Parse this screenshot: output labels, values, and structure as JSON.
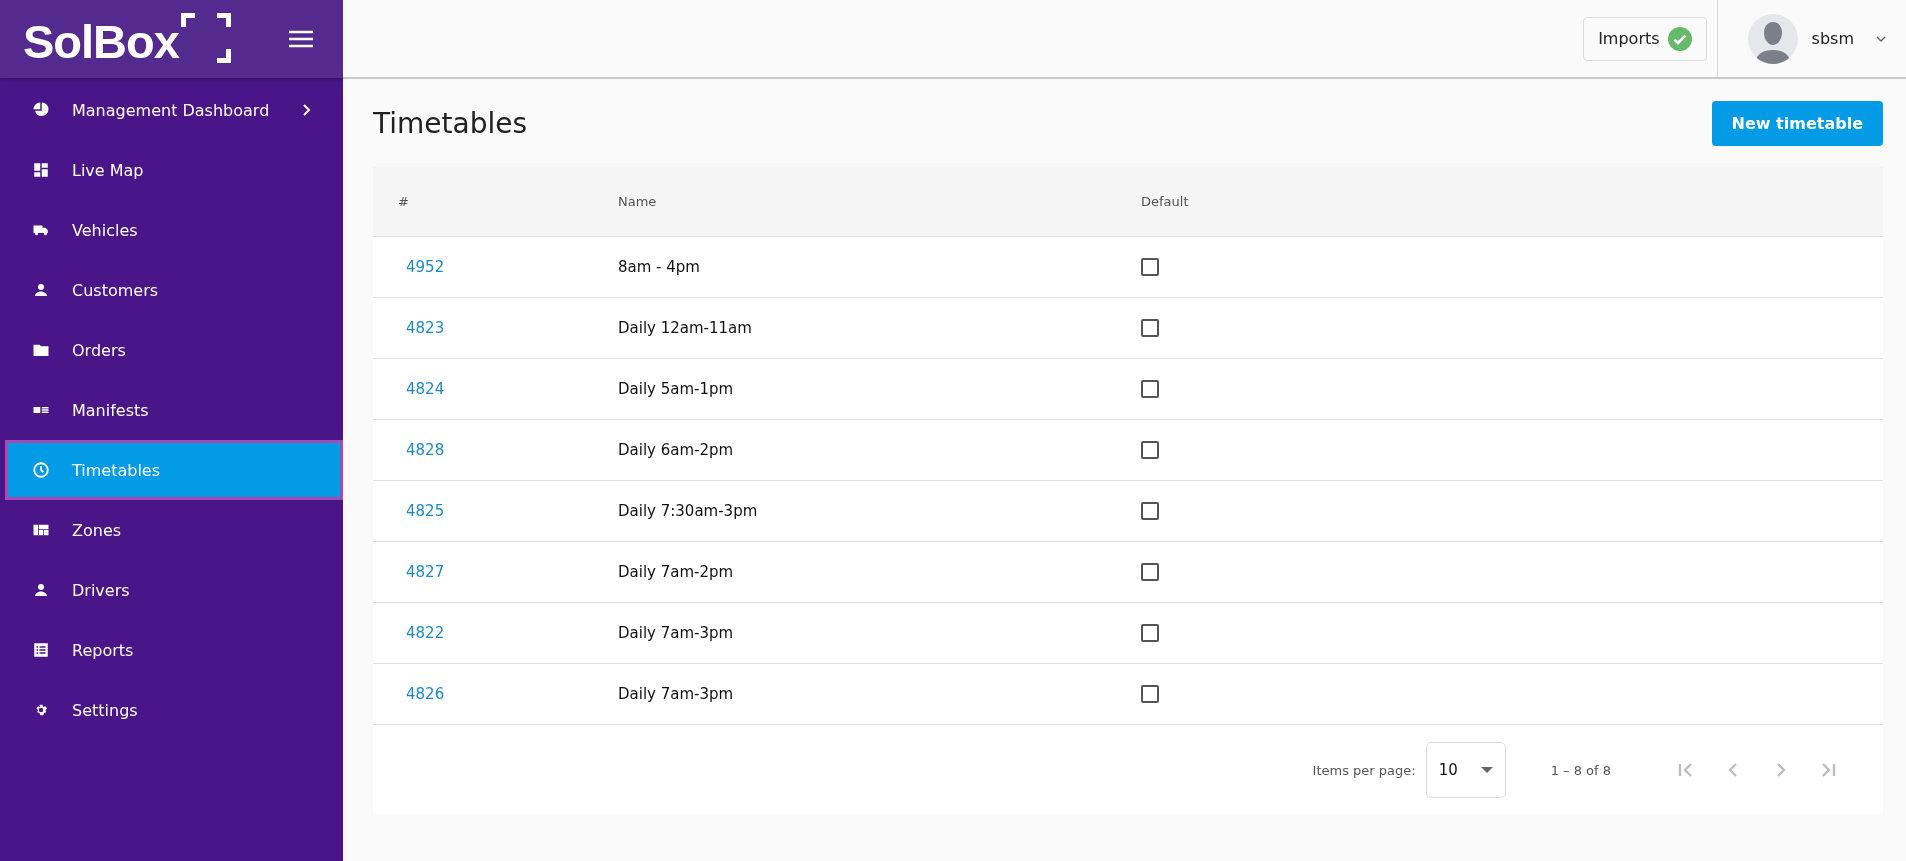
{
  "sidebar": {
    "logo": "SolBox",
    "items": [
      {
        "label": "Management Dashboard",
        "expandable": true,
        "selected": false
      },
      {
        "label": "Live Map",
        "expandable": false,
        "selected": false
      },
      {
        "label": "Vehicles",
        "expandable": false,
        "selected": false
      },
      {
        "label": "Customers",
        "expandable": false,
        "selected": false
      },
      {
        "label": "Orders",
        "expandable": false,
        "selected": false
      },
      {
        "label": "Manifests",
        "expandable": false,
        "selected": false
      },
      {
        "label": "Timetables",
        "expandable": false,
        "selected": true
      },
      {
        "label": "Zones",
        "expandable": false,
        "selected": false
      },
      {
        "label": "Drivers",
        "expandable": false,
        "selected": false
      },
      {
        "label": "Reports",
        "expandable": false,
        "selected": false
      },
      {
        "label": "Settings",
        "expandable": false,
        "selected": false
      }
    ]
  },
  "header": {
    "imports": {
      "label": "Imports",
      "done": true
    },
    "user": {
      "name": "sbsm"
    }
  },
  "page": {
    "title": "Timetables",
    "new_button": "New timetable"
  },
  "table": {
    "columns": [
      "#",
      "Name",
      "Default"
    ],
    "rows": [
      {
        "id": "4952",
        "name": "8am - 4pm",
        "default": false
      },
      {
        "id": "4823",
        "name": "Daily 12am-11am",
        "default": false
      },
      {
        "id": "4824",
        "name": "Daily 5am-1pm",
        "default": false
      },
      {
        "id": "4828",
        "name": "Daily 6am-2pm",
        "default": false
      },
      {
        "id": "4825",
        "name": "Daily 7:30am-3pm",
        "default": false
      },
      {
        "id": "4827",
        "name": "Daily 7am-2pm",
        "default": false
      },
      {
        "id": "4822",
        "name": "Daily 7am-3pm",
        "default": false
      },
      {
        "id": "4826",
        "name": "Daily 7am-3pm",
        "default": false
      }
    ]
  },
  "paginator": {
    "label": "Items per page:",
    "page_size": "10",
    "range": "1 – 8 of 8",
    "first_disabled": true,
    "prev_disabled": true,
    "next_disabled": true,
    "last_disabled": true
  }
}
